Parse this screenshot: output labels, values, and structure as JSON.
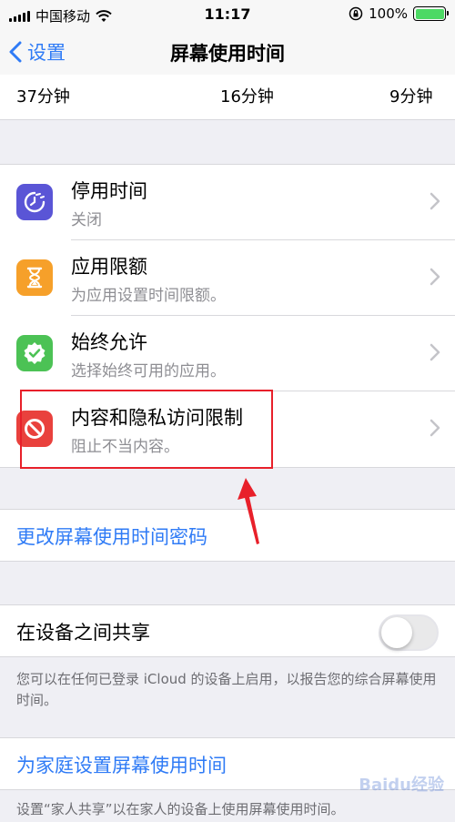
{
  "status_bar": {
    "carrier": "中国移动",
    "time": "11:17",
    "battery": "100%"
  },
  "nav": {
    "back_label": "设置",
    "title": "屏幕使用时间"
  },
  "usage_values": [
    "37分钟",
    "16分钟",
    "9分钟"
  ],
  "settings": [
    {
      "title": "停用时间",
      "subtitle": "关闭",
      "icon": "downtime-icon",
      "color": "#5a55d6"
    },
    {
      "title": "应用限额",
      "subtitle": "为应用设置时间限额。",
      "icon": "hourglass-icon",
      "color": "#f6a02a"
    },
    {
      "title": "始终允许",
      "subtitle": "选择始终可用的应用。",
      "icon": "checkmark-badge-icon",
      "color": "#4cc255"
    },
    {
      "title": "内容和隐私访问限制",
      "subtitle": "阻止不当内容。",
      "icon": "prohibited-icon",
      "color": "#e9413d"
    }
  ],
  "change_passcode": "更改屏幕使用时间密码",
  "share": {
    "label": "在设备之间共享",
    "footnote": "您可以在任何已登录 iCloud 的设备上启用，以报告您的综合屏幕使用时间。"
  },
  "family": {
    "label": "为家庭设置屏幕使用时间",
    "footnote": "设置“家人共享”以在家人的设备上使用屏幕使用时间。"
  },
  "watermark": "Baidu经验",
  "colors": {
    "accent": "#2f7bf6",
    "highlight": "#e8202a",
    "secondary_text": "#8e8e93"
  }
}
